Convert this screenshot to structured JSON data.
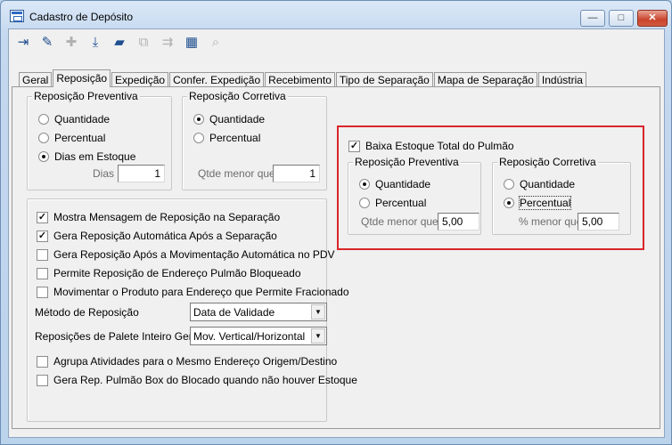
{
  "window": {
    "title": "Cadastro de Depósito",
    "controls": {
      "minimize": "—",
      "maximize": "□",
      "close": "✕"
    }
  },
  "toolbar": {
    "buttons": [
      {
        "name": "exit-icon",
        "glyph": "⇥",
        "state": "enabled"
      },
      {
        "name": "edit-icon",
        "glyph": "✎",
        "state": "enabled"
      },
      {
        "name": "add-icon",
        "glyph": "✚",
        "state": "disabled"
      },
      {
        "name": "save-icon",
        "glyph": "⤓",
        "state": "enabled"
      },
      {
        "name": "open-folder-icon",
        "glyph": "▰",
        "state": "enabled"
      },
      {
        "name": "copy-icon",
        "glyph": "⧉",
        "state": "disabled"
      },
      {
        "name": "move-icon",
        "glyph": "⇉",
        "state": "disabled"
      },
      {
        "name": "grid-icon",
        "glyph": "▦",
        "state": "enabled"
      },
      {
        "name": "binoculars-icon",
        "glyph": "⌕",
        "state": "disabled"
      }
    ]
  },
  "tabs": [
    "Geral",
    "Reposição",
    "Expedição",
    "Confer. Expedição",
    "Recebimento",
    "Tipo de Separação",
    "Mapa de Separação",
    "Indústria"
  ],
  "active_tab": "Reposição",
  "preventiva": {
    "title": "Reposição Preventiva",
    "options": [
      "Quantidade",
      "Percentual",
      "Dias em Estoque"
    ],
    "selected": "Dias em Estoque",
    "dias_label": "Dias",
    "dias_value": "1"
  },
  "corretiva": {
    "title": "Reposição Corretiva",
    "options": [
      "Quantidade",
      "Percentual"
    ],
    "selected": "Quantidade",
    "qtde_label": "Qtde menor que",
    "qtde_value": "1"
  },
  "pulmao": {
    "check_label": "Baixa Estoque Total do Pulmão",
    "checked": true,
    "preventiva": {
      "title": "Reposição Preventiva",
      "options": [
        "Quantidade",
        "Percentual"
      ],
      "selected": "Quantidade",
      "field_label": "Qtde menor que",
      "field_value": "5,00"
    },
    "corretiva": {
      "title": "Reposição Corretiva",
      "options": [
        "Quantidade",
        "Percentual"
      ],
      "selected": "Percentual",
      "field_label": "% menor que",
      "field_value": "5,00"
    }
  },
  "options": {
    "checks": [
      {
        "label": "Mostra Mensagem de Reposição na Separação",
        "checked": true
      },
      {
        "label": "Gera Reposição Automática Após a Separação",
        "checked": true
      },
      {
        "label": "Gera Reposição Após a Movimentação Automática no PDV",
        "checked": false
      },
      {
        "label": "Permite Reposição de Endereço Pulmão Bloqueado",
        "checked": false
      },
      {
        "label": "Movimentar o Produto para Endereço que Permite Fracionado",
        "checked": false
      }
    ],
    "metodo_label": "Método de Reposição",
    "metodo_value": "Data de Validade",
    "palete_label": "Reposições de Palete Inteiro Gerar",
    "palete_value": "Mov. Vertical/Horizontal",
    "checks_bottom": [
      {
        "label": "Agrupa Atividades para o Mesmo Endereço Origem/Destino",
        "checked": false
      },
      {
        "label": "Gera Rep. Pulmão Box do Blocado quando não houver Estoque",
        "checked": false
      }
    ]
  },
  "colors": {
    "highlight": "#d9262a",
    "window_frame": "#b9d1ea",
    "panel": "#f0f0f0"
  }
}
